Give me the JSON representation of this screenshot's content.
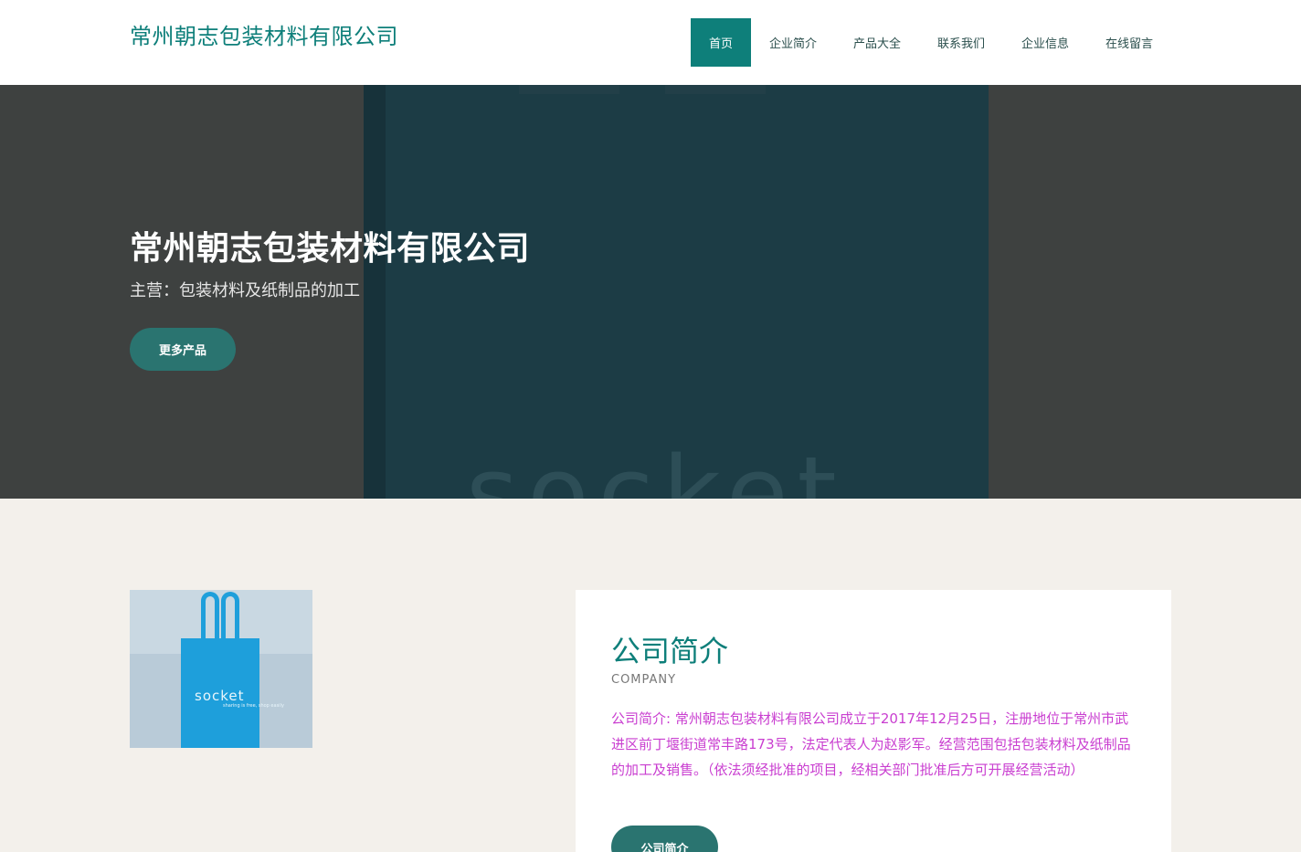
{
  "header": {
    "logo_text": "常州朝志包装材料有限公司",
    "nav": [
      {
        "label": "首页",
        "active": true
      },
      {
        "label": "企业简介",
        "active": false
      },
      {
        "label": "产品大全",
        "active": false
      },
      {
        "label": "联系我们",
        "active": false
      },
      {
        "label": "企业信息",
        "active": false
      },
      {
        "label": "在线留言",
        "active": false
      }
    ]
  },
  "hero": {
    "title": "常州朝志包装材料有限公司",
    "subtitle": "主营：包装材料及纸制品的加工",
    "button_label": "更多产品",
    "image_text": "socket"
  },
  "product_image": {
    "text": "socket",
    "small_text": "sharing is free, shop easily"
  },
  "about": {
    "title": "公司简介",
    "subtitle_en": "COMPANY",
    "text": "公司简介: 常州朝志包装材料有限公司成立于2017年12月25日，注册地位于常州市武进区前丁堰街道常丰路173号，法定代表人为赵影军。经营范围包括包装材料及纸制品的加工及销售。（依法须经批准的项目，经相关部门批准后方可开展经营活动）",
    "button_label": "公司简介"
  },
  "colors": {
    "accent": "#0e7f7a",
    "button": "#2a7470",
    "about_text": "#c93ed0",
    "page_bg": "#f3f0eb"
  }
}
